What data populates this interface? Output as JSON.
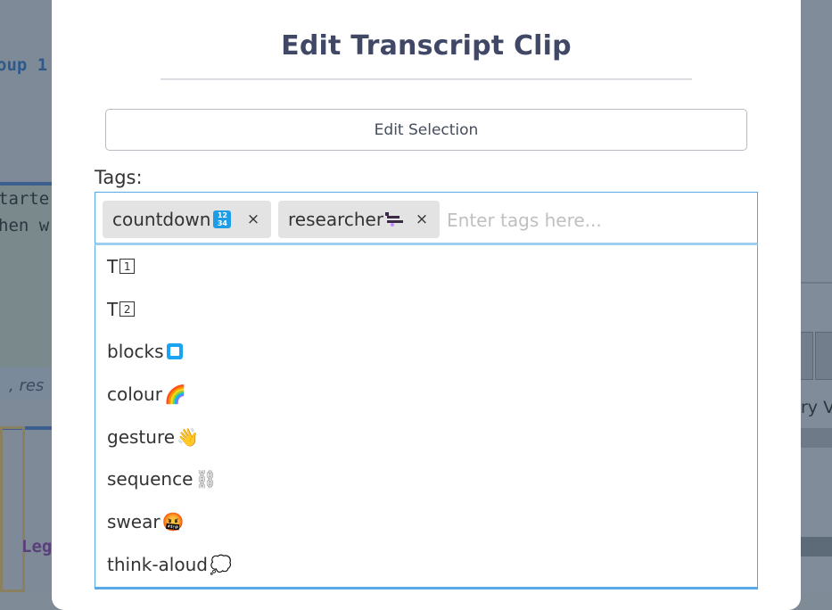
{
  "modal": {
    "title": "Edit Transcript Clip",
    "edit_selection_label": "Edit Selection",
    "tags_label": "Tags:"
  },
  "tags": {
    "selected": [
      {
        "label": "countdown",
        "icon": "countdown-keycap-icon",
        "remove": "×"
      },
      {
        "label": "researcher",
        "icon": "researcher-icon",
        "remove": "×"
      }
    ],
    "input_placeholder": "Enter tags here...",
    "input_value": ""
  },
  "options": [
    {
      "label": "T",
      "icon": "keycap-1-icon",
      "glyph": "1"
    },
    {
      "label": "T",
      "icon": "keycap-2-icon",
      "glyph": "2"
    },
    {
      "label": "blocks",
      "icon": "blue-square-icon"
    },
    {
      "label": "colour",
      "icon": "rainbow-icon",
      "glyph": "🌈"
    },
    {
      "label": "gesture",
      "icon": "waving-hand-icon",
      "glyph": "👋"
    },
    {
      "label": "sequence",
      "icon": "chain-icon",
      "glyph": "⛓"
    },
    {
      "label": "swear",
      "icon": "angry-face-icon",
      "glyph": "🤬"
    },
    {
      "label": "think-aloud",
      "icon": "thought-bubble-icon",
      "glyph": "💭"
    }
  ],
  "background": {
    "snippet_1": "oup 1",
    "snippet_2": "tarte",
    "snippet_3": "hen w",
    "snippet_4": ", res",
    "snippet_5": "Leg",
    "snippet_6": "ry V"
  },
  "colors": {
    "accent_border": "#5aa9e6",
    "title": "#404866",
    "chip_bg": "#e3e3e3"
  }
}
